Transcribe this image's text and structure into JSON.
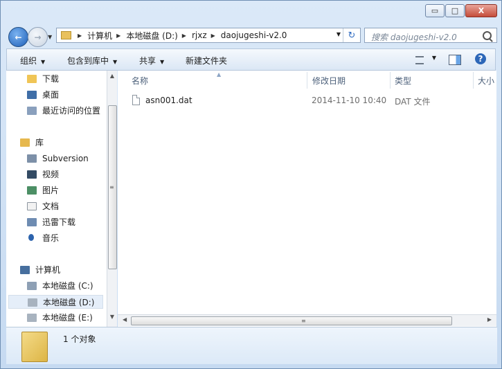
{
  "window": {
    "minimize_glyph": "▭",
    "maximize_glyph": "□",
    "close_glyph": "X"
  },
  "navigation": {
    "back_icon": "←",
    "forward_icon": "→",
    "history_dropdown": "▼",
    "breadcrumbs": [
      "计算机",
      "本地磁盘 (D:)",
      "rjxz",
      "daojugeshi-v2.0"
    ],
    "refresh_icon": "↻"
  },
  "search": {
    "placeholder": "搜索 daojugeshi-v2.0"
  },
  "toolbar": {
    "organize_label": "组织",
    "include_library_label": "包含到库中",
    "share_label": "共享",
    "new_folder_label": "新建文件夹",
    "dropdown_glyph": "▼"
  },
  "sidebar": {
    "items": [
      {
        "label": "下载",
        "icon": "downloads-folder-icon"
      },
      {
        "label": "桌面",
        "icon": "desktop-icon"
      },
      {
        "label": "最近访问的位置",
        "icon": "recent-places-icon"
      },
      {
        "label": "库",
        "icon": "libraries-icon"
      },
      {
        "label": "Subversion",
        "icon": "subversion-icon"
      },
      {
        "label": "视频",
        "icon": "videos-icon"
      },
      {
        "label": "图片",
        "icon": "pictures-icon"
      },
      {
        "label": "文档",
        "icon": "documents-icon"
      },
      {
        "label": "迅雷下载",
        "icon": "xunlei-downloads-icon"
      },
      {
        "label": "音乐",
        "icon": "music-icon"
      },
      {
        "label": "计算机",
        "icon": "computer-icon"
      },
      {
        "label": "本地磁盘 (C:)",
        "icon": "drive-c-icon"
      },
      {
        "label": "本地磁盘 (D:)",
        "icon": "drive-d-icon"
      },
      {
        "label": "本地磁盘 (E:)",
        "icon": "drive-e-icon"
      }
    ],
    "selected": "本地磁盘 (D:)"
  },
  "file_list": {
    "columns": [
      "名称",
      "修改日期",
      "类型",
      "大小"
    ],
    "rows": [
      {
        "name": "asn001.dat",
        "modified": "2014-11-10 10:40",
        "type": "DAT 文件",
        "icon": "file-icon"
      }
    ]
  },
  "scrollbars": {
    "up_glyph": "▲",
    "down_glyph": "▼",
    "left_glyph": "◀",
    "right_glyph": "▶",
    "grip_glyph": "≡"
  },
  "status": {
    "count_text": "1 个对象"
  }
}
